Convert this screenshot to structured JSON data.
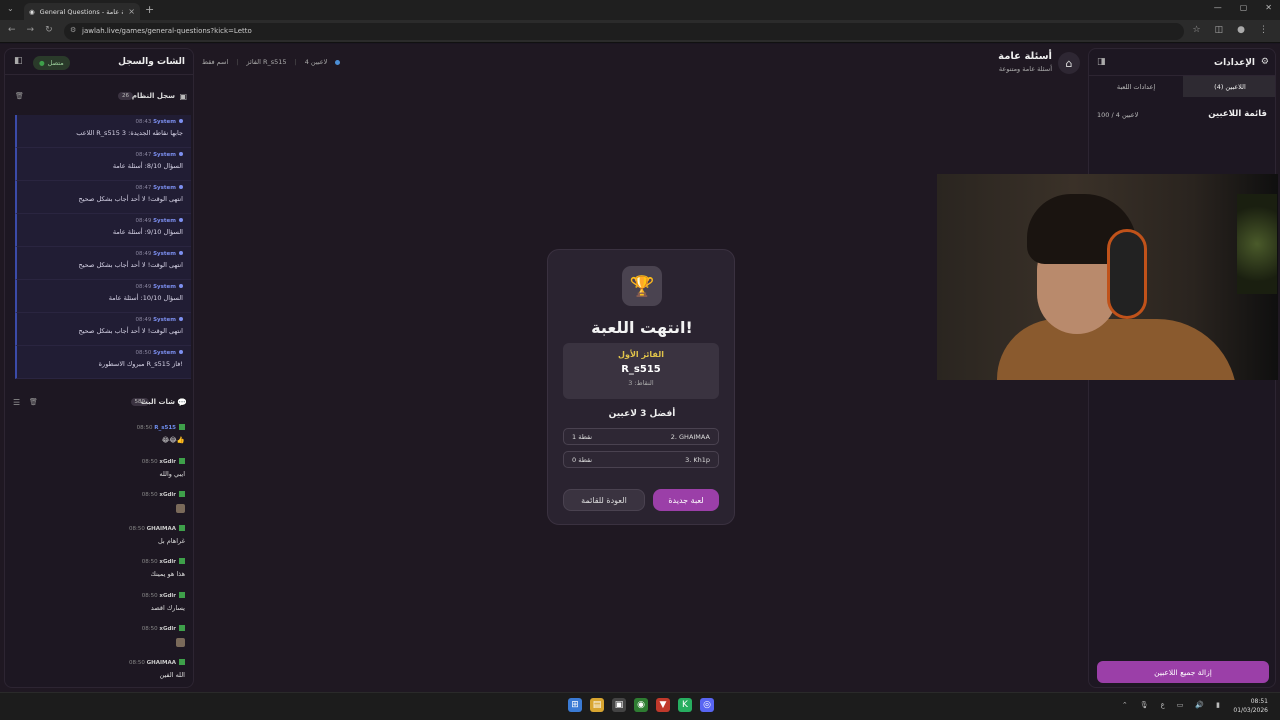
{
  "browser": {
    "tab_title": "General Questions - أسئلة عامة",
    "url": "jawlah.live/games/general-questions?kick=Letto"
  },
  "left": {
    "title": "الشات والسجل",
    "status": "متصل",
    "system_log": {
      "title": "سجل النظام",
      "count": "26",
      "items": [
        {
          "name": "System",
          "time": "08:43",
          "text": "اللاعب R_s515 جابها نقاطه الجديدة: 3"
        },
        {
          "name": "System",
          "time": "08:47",
          "text": "السؤال 8/10: أسئلة عامة"
        },
        {
          "name": "System",
          "time": "08:47",
          "text": "انتهى الوقت! لا أحد أجاب بشكل صحيح"
        },
        {
          "name": "System",
          "time": "08:49",
          "text": "السؤال 9/10: أسئلة عامة"
        },
        {
          "name": "System",
          "time": "08:49",
          "text": "انتهى الوقت! لا أحد أجاب بشكل صحيح"
        },
        {
          "name": "System",
          "time": "08:49",
          "text": "السؤال 10/10: أسئلة عامة"
        },
        {
          "name": "System",
          "time": "08:49",
          "text": "انتهى الوقت! لا أحد أجاب بشكل صحيح"
        },
        {
          "name": "System",
          "time": "08:50",
          "text": "مبروك الاسطورة R_s515 فاز!"
        }
      ]
    },
    "live_chat": {
      "title": "شات البث",
      "count": "580",
      "items": [
        {
          "name": "R_s515",
          "time": "08:50",
          "text": "😂😂👍"
        },
        {
          "name": "xGdlr",
          "time": "08:50",
          "text": "ايبي والله"
        },
        {
          "name": "xGdlr",
          "time": "08:50",
          "text": ""
        },
        {
          "name": "GHAIMAA",
          "time": "08:50",
          "text": "غراهام بل"
        },
        {
          "name": "xGdlr",
          "time": "08:50",
          "text": "هذا هو يمينك"
        },
        {
          "name": "xGdlr",
          "time": "08:50",
          "text": "يسارك اقصد"
        },
        {
          "name": "xGdlr",
          "time": "08:50",
          "text": ""
        },
        {
          "name": "GHAIMAA",
          "time": "08:50",
          "text": "الله الفين"
        }
      ]
    }
  },
  "crumbs": {
    "players": "4 لاعبين",
    "winner": "الفائز R_s515",
    "hint": "اسم فقط"
  },
  "page": {
    "title": "أسئلة عامة",
    "subtitle": "أسئلة عامة ومتنوعة"
  },
  "result": {
    "title": "انتهت اللعبة!",
    "winner_label": "الفائز الأول",
    "winner_name": "R_s515",
    "winner_points": "النقاط: 3",
    "top3_title": "أفضل 3 لاعبين",
    "ranks": [
      {
        "name": "2. GHAIMAA",
        "points": "1 نقطة"
      },
      {
        "name": "3. Kh1p",
        "points": "0 نقطة"
      }
    ],
    "back_button": "العودة للقائمة",
    "new_game_button": "لعبة جديدة"
  },
  "right": {
    "title": "الإعدادات",
    "tabs": [
      "إعدادات اللعبة",
      "اللاعبين (4)"
    ],
    "active_tab": 1,
    "list_title": "قائمة اللاعبين",
    "count": "100 / 4 لاعبين",
    "remove_all": "إزالة جميع اللاعبين"
  },
  "taskbar": {
    "time": "08:51",
    "date": "01/03/2026"
  }
}
